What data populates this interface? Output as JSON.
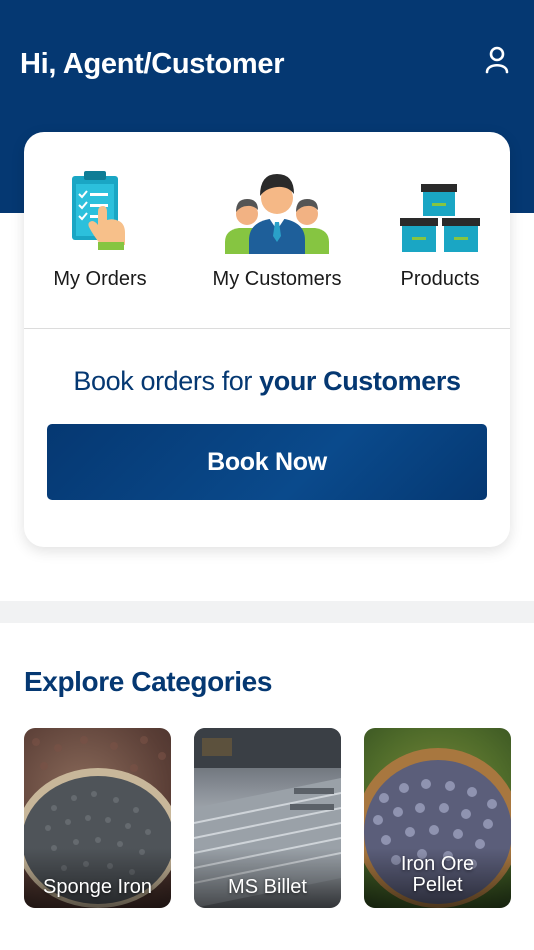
{
  "header": {
    "greeting": "Hi, Agent/Customer",
    "profile_icon": "user-icon",
    "bg_color": "#053872"
  },
  "quick_actions": [
    {
      "label": "My Orders",
      "icon": "clipboard-checklist-icon"
    },
    {
      "label": "My Customers",
      "icon": "customers-group-icon"
    },
    {
      "label": "Products",
      "icon": "boxes-icon"
    }
  ],
  "booking": {
    "text_prefix": "Book orders for ",
    "text_emphasis": "your Customers",
    "button_label": "Book Now"
  },
  "categories": {
    "title": "Explore Categories",
    "items": [
      {
        "label": "Sponge Iron"
      },
      {
        "label": "MS Billet"
      },
      {
        "label_line1": "Iron Ore",
        "label_line2": "Pellet"
      }
    ]
  }
}
